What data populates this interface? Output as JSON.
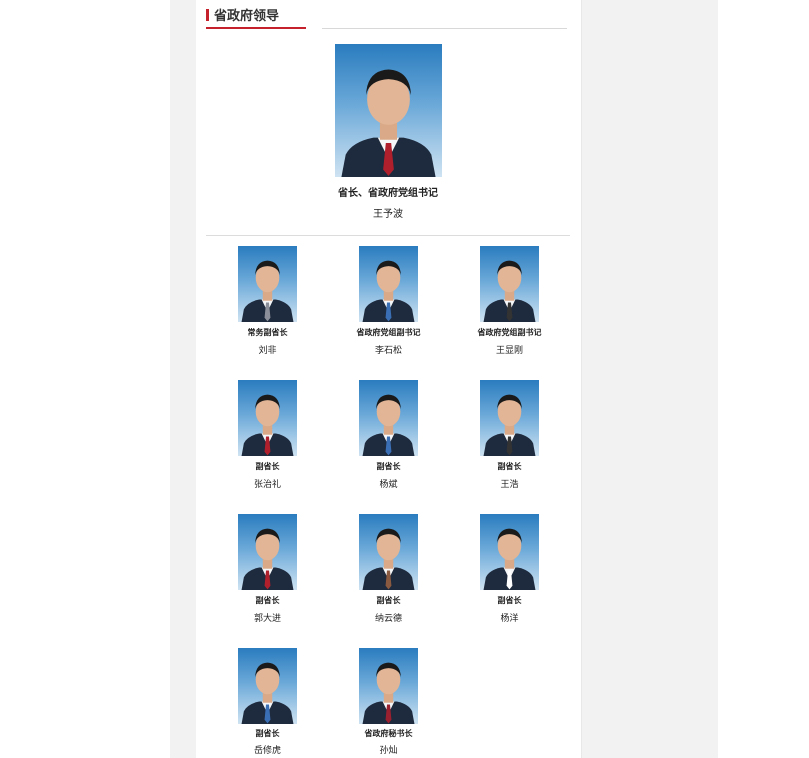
{
  "section": {
    "title": "省政府领导"
  },
  "leader": {
    "title": "省长、省政府党组书记",
    "name": "王予波",
    "tie": "#b0202c"
  },
  "members": [
    {
      "title": "常务副省长",
      "name": "刘非",
      "tie": "#8a8f99"
    },
    {
      "title": "省政府党组副书记",
      "name": "李石松",
      "tie": "#3a6fb5"
    },
    {
      "title": "省政府党组副书记",
      "name": "王显刚",
      "tie": "#333333"
    },
    {
      "title": "副省长",
      "name": "张治礼",
      "tie": "#b0202c"
    },
    {
      "title": "副省长",
      "name": "杨斌",
      "tie": "#3a6fb5"
    },
    {
      "title": "副省长",
      "name": "王浩",
      "tie": "#333333"
    },
    {
      "title": "副省长",
      "name": "郭大进",
      "tie": "#b0202c"
    },
    {
      "title": "副省长",
      "name": "纳云德",
      "tie": "#8a5a40"
    },
    {
      "title": "副省长",
      "name": "杨洋",
      "tie": "#ffffff"
    },
    {
      "title": "副省长",
      "name": "岳修虎",
      "tie": "#3a6fb5"
    },
    {
      "title": "省政府秘书长",
      "name": "孙灿",
      "tie": "#9a2030"
    }
  ]
}
